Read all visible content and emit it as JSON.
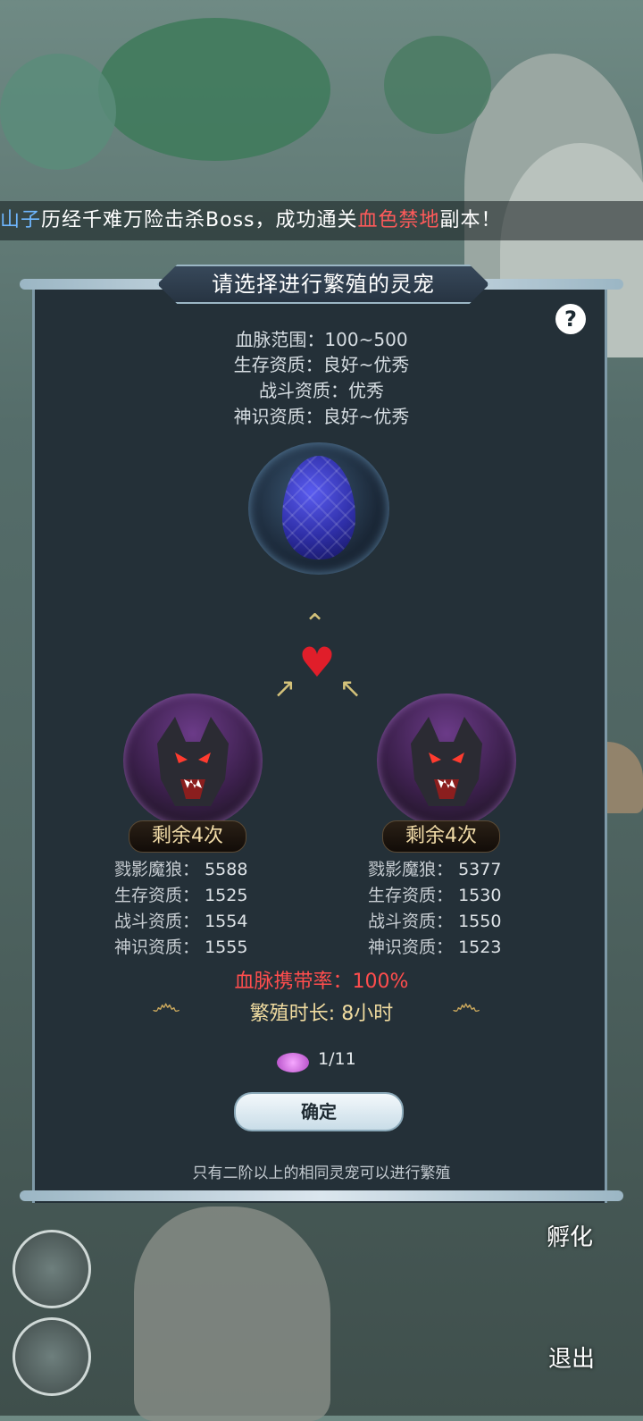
{
  "marquee": {
    "part1": "山子",
    "part2": "历经千难万险击杀Boss，成功通关",
    "part3": "血色禁地",
    "part4": "副本！"
  },
  "dialog": {
    "title": "请选择进行繁殖的灵宠",
    "help_icon": "question-icon",
    "requirements": [
      "血脉范围：100~500",
      "生存资质：良好~优秀",
      "战斗资质：优秀",
      "神识资质：良好~优秀"
    ],
    "pets": [
      {
        "remaining": "剩余4次",
        "stats": [
          {
            "label": "戮影魔狼：",
            "value": "5588"
          },
          {
            "label": "生存资质：",
            "value": "1525"
          },
          {
            "label": "战斗资质：",
            "value": "1554"
          },
          {
            "label": "神识资质：",
            "value": "1555"
          }
        ]
      },
      {
        "remaining": "剩余4次",
        "stats": [
          {
            "label": "戮影魔狼：",
            "value": "5377"
          },
          {
            "label": "生存资质：",
            "value": "1530"
          },
          {
            "label": "战斗资质：",
            "value": "1550"
          },
          {
            "label": "神识资质：",
            "value": "1523"
          }
        ]
      }
    ],
    "bloodline_rate": "血脉携带率：100%",
    "duration": "繁殖时长: 8小时",
    "item_count": "1/11",
    "confirm_label": "确定",
    "note": "只有二阶以上的相同灵宠可以进行繁殖"
  },
  "side": {
    "hatch_label": "孵化",
    "exit_label": "退出"
  },
  "colors": {
    "panel": "#243038",
    "highlight_red": "#ff4d4d",
    "highlight_blue": "#6fb7ff",
    "gold": "#f1dca0"
  }
}
